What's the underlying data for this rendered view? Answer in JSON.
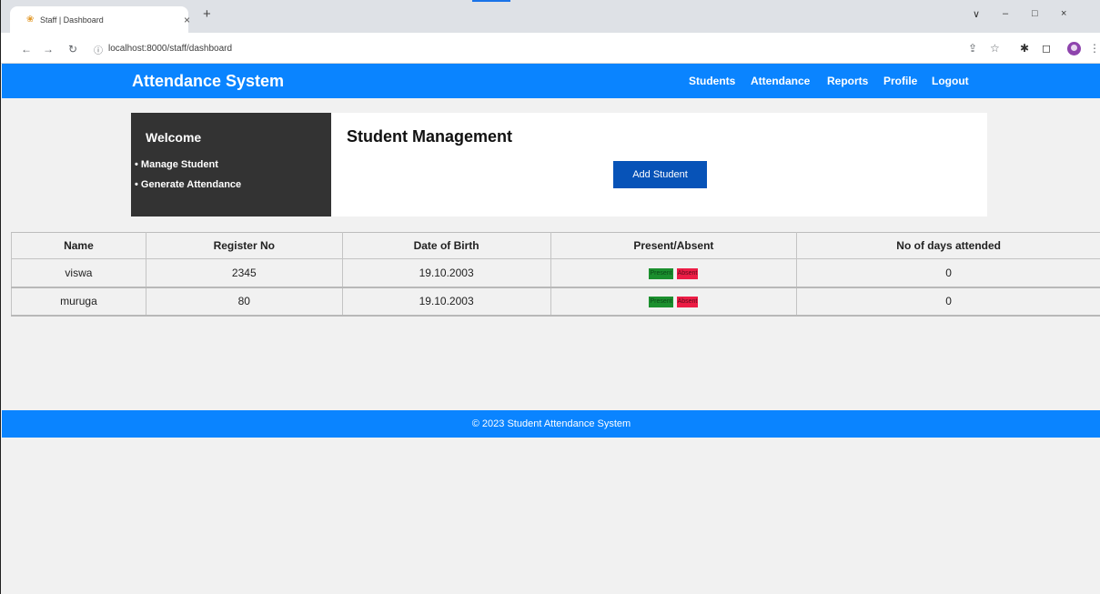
{
  "browser": {
    "tab_title": "Staff | Dashboard",
    "tab_close": "×",
    "new_tab": "+",
    "url": "localhost:8000/staff/dashboard",
    "window_controls": [
      "∨",
      "–",
      "□",
      "×"
    ]
  },
  "header": {
    "brand": "Attendance System",
    "nav": [
      "Students",
      "Attendance",
      "Reports",
      "Profile",
      "Logout"
    ]
  },
  "sidebar": {
    "title": "Welcome",
    "items": [
      "Manage Student",
      "Generate Attendance"
    ]
  },
  "main": {
    "title": "Student Management",
    "add_button": "Add Student"
  },
  "table": {
    "headers": [
      "Name",
      "Register No",
      "Date of Birth",
      "Present/Absent",
      "No of days attended"
    ],
    "present_label": "Present",
    "absent_label": "Absent",
    "rows": [
      {
        "name": "viswa",
        "register_no": "2345",
        "dob": "19.10.2003",
        "days_attended": "0"
      },
      {
        "name": "muruga",
        "register_no": "80",
        "dob": "19.10.2003",
        "days_attended": "0"
      }
    ]
  },
  "footer": {
    "text": "© 2023 Student Attendance System"
  },
  "colors": {
    "brand_blue": "#0a84ff",
    "button_blue": "#0753b8",
    "sidebar_dark": "#333333",
    "present_green": "#1b8f2e",
    "absent_red": "#ec1c45"
  }
}
